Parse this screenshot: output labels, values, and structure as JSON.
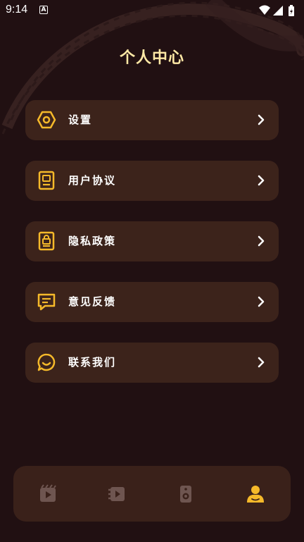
{
  "status": {
    "time": "9:14"
  },
  "page_title": "个人中心",
  "menu": [
    {
      "label": "设置",
      "icon": "hexagon-settings-icon"
    },
    {
      "label": "用户协议",
      "icon": "document-user-icon"
    },
    {
      "label": "隐私政策",
      "icon": "document-lock-icon"
    },
    {
      "label": "意见反馈",
      "icon": "chat-message-icon"
    },
    {
      "label": "联系我们",
      "icon": "chat-smile-icon"
    }
  ],
  "tabs": [
    {
      "icon": "film-play-icon",
      "active": false
    },
    {
      "icon": "video-play-icon",
      "active": false
    },
    {
      "icon": "speaker-icon",
      "active": false
    },
    {
      "icon": "user-profile-icon",
      "active": true
    }
  ],
  "colors": {
    "background": "#211012",
    "card": "#3c231b",
    "accent": "#f5b92a",
    "title": "#ffe9a6",
    "inactive_tab": "#6e5550"
  }
}
